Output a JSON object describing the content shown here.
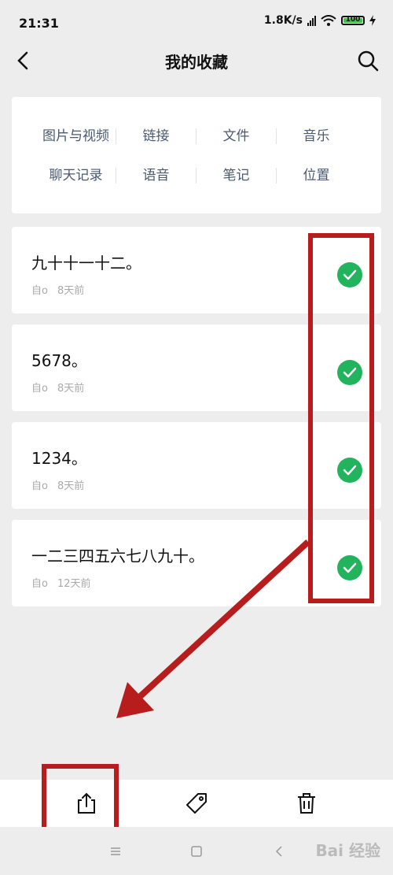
{
  "status_bar": {
    "time": "21:31",
    "network_speed": "1.8K/s",
    "battery": "100",
    "battery_color": "#3cc83c"
  },
  "header": {
    "title": "我的收藏",
    "back_icon": "chevron-left-icon",
    "search_icon": "search-icon"
  },
  "categories": {
    "row1": [
      "图片与视频",
      "链接",
      "文件",
      "音乐"
    ],
    "row2": [
      "聊天记录",
      "语音",
      "笔记",
      "位置"
    ]
  },
  "items": [
    {
      "text": "九十十一十二。",
      "source": "自o",
      "time": "8天前",
      "selected": true
    },
    {
      "text": "5678。",
      "source": "自o",
      "time": "8天前",
      "selected": true
    },
    {
      "text": "1234。",
      "source": "自o",
      "time": "8天前",
      "selected": true
    },
    {
      "text": "一二三四五六七八九十。",
      "source": "自o",
      "time": "12天前",
      "selected": true
    }
  ],
  "toolbar": {
    "share_icon": "share-icon",
    "tag_icon": "tag-icon",
    "delete_icon": "trash-icon"
  },
  "navbar": {
    "menu_icon": "menu-icon",
    "home_icon": "square-icon",
    "back_icon": "triangle-back-icon"
  },
  "watermark": "Bai 经验",
  "colors": {
    "accent_check": "#22b45c",
    "annotation_red": "#b81d1d",
    "category_text": "#4a5a70"
  }
}
